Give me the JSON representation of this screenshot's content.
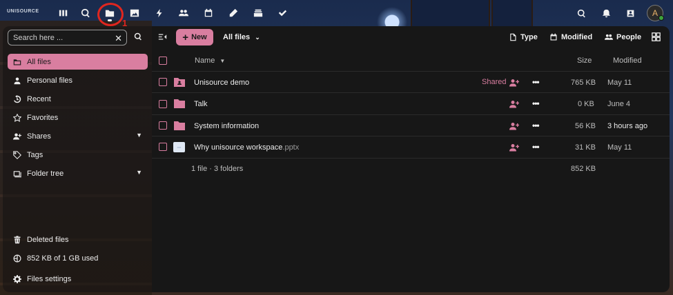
{
  "topbar": {
    "logo": "UNISOURCE",
    "apps": [
      {
        "icon": "dashboard-icon"
      },
      {
        "icon": "search-app-icon"
      },
      {
        "icon": "folder-icon",
        "active": true
      },
      {
        "icon": "photos-icon"
      },
      {
        "icon": "activity-icon"
      },
      {
        "icon": "contacts-icon"
      },
      {
        "icon": "calendar-icon"
      },
      {
        "icon": "notes-icon"
      },
      {
        "icon": "deck-icon"
      },
      {
        "icon": "tasks-icon"
      }
    ],
    "annotation_number": "1",
    "avatar_letter": "A"
  },
  "sidebar": {
    "search_placeholder": "Search here ...",
    "items": [
      {
        "label": "All files",
        "icon": "folder-outline-icon",
        "active": true
      },
      {
        "label": "Personal files",
        "icon": "person-icon"
      },
      {
        "label": "Recent",
        "icon": "history-icon"
      },
      {
        "label": "Favorites",
        "icon": "star-icon"
      },
      {
        "label": "Shares",
        "icon": "share-icon",
        "expandable": true
      },
      {
        "label": "Tags",
        "icon": "tag-icon"
      },
      {
        "label": "Folder tree",
        "icon": "folder-tree-icon",
        "expandable": true
      }
    ],
    "footer": [
      {
        "label": "Deleted files",
        "icon": "trash-icon"
      },
      {
        "label": "852 KB of 1 GB used",
        "icon": "storage-pie-icon"
      },
      {
        "label": "Files settings",
        "icon": "gear-icon"
      }
    ]
  },
  "toolbar": {
    "new_label": "New",
    "location_label": "All files",
    "filters": [
      "Type",
      "Modified",
      "People"
    ]
  },
  "table": {
    "headers": {
      "name": "Name",
      "size": "Size",
      "modified": "Modified"
    },
    "rows": [
      {
        "name": "Unisource demo",
        "ext": "",
        "type": "shared-folder",
        "shared_label": "Shared",
        "size": "765 KB",
        "modified": "May 11"
      },
      {
        "name": "Talk",
        "ext": "",
        "type": "folder",
        "shared_label": "",
        "size": "0 KB",
        "modified": "June 4"
      },
      {
        "name": "System information",
        "ext": "",
        "type": "folder",
        "shared_label": "",
        "size": "56 KB",
        "modified": "3 hours ago"
      },
      {
        "name": "Why unisource workspace",
        "ext": ".pptx",
        "type": "file",
        "shared_label": "",
        "size": "31 KB",
        "modified": "May 11"
      }
    ],
    "summary": "1 file · 3 folders",
    "summary_size": "852 KB"
  },
  "colors": {
    "accent": "#d97ea0",
    "annotation": "#e0261f",
    "background": "#171717"
  }
}
